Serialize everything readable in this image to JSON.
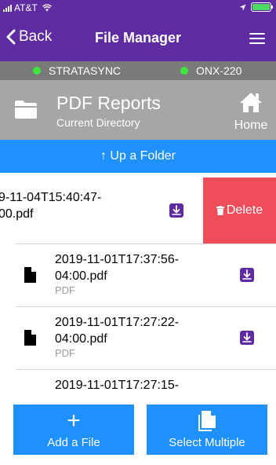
{
  "status_bar": {
    "carrier": "AT&T",
    "icons": [
      "signal-icon",
      "wifi-icon",
      "location-icon",
      "battery-charging-icon"
    ]
  },
  "nav": {
    "back_label": "Back",
    "title": "File Manager",
    "menu_icon": "hamburger-menu-icon"
  },
  "devices": [
    {
      "name": "STRATASYNC",
      "status_color": "#3ee53e"
    },
    {
      "name": "ONX-220",
      "status_color": "#3ee53e"
    }
  ],
  "directory": {
    "title": "PDF Reports",
    "subtitle": "Current Directory",
    "home_label": "Home"
  },
  "up_folder_label": "↑  Up a Folder",
  "files": [
    {
      "name": "9-11-04T15:40:47-\n00.pdf",
      "type": "",
      "swiped": true,
      "delete_label": "Delete"
    },
    {
      "name": "2019-11-01T17:37:56-\n04:00.pdf",
      "type": "PDF"
    },
    {
      "name": "2019-11-01T17:27:22-\n04:00.pdf",
      "type": "PDF"
    },
    {
      "name": "2019-11-01T17:27:15-",
      "type": ""
    }
  ],
  "actions": {
    "add_label": "Add a File",
    "select_label": "Select Multiple"
  },
  "colors": {
    "brand_purple": "#5e2ba0",
    "action_blue": "#1e90ff",
    "delete_red": "#f04d5a",
    "device_bar_gray": "#7a7a7a",
    "header_gray": "#a6a6a6"
  }
}
